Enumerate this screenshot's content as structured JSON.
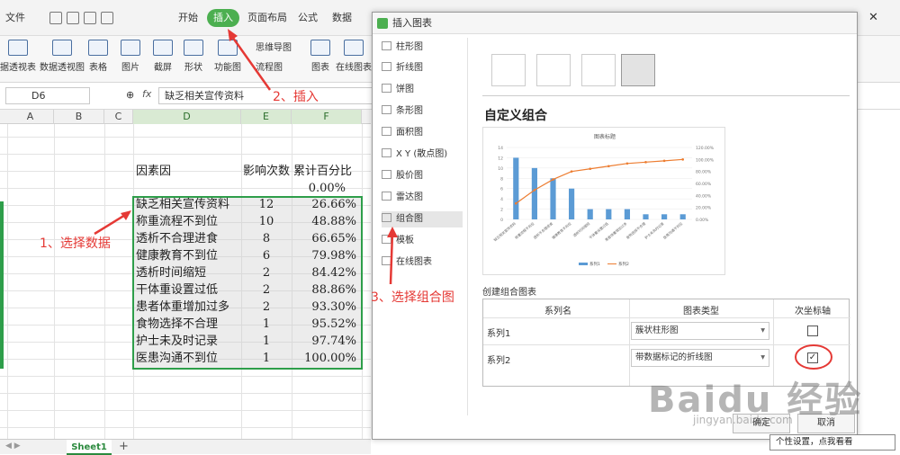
{
  "menubar": {
    "file": "文件",
    "tabs": [
      "开始",
      "插入",
      "页面布局",
      "公式",
      "数据"
    ]
  },
  "ribbon": {
    "buttons": [
      "据透视表",
      "数据透视图",
      "表格",
      "图片",
      "截屏",
      "形状",
      "功能图",
      "思维导图",
      "流程图",
      "图表",
      "在线图表"
    ]
  },
  "formula": {
    "namebox": "D6",
    "fx": "fx",
    "content": "缺乏相关宣传资料"
  },
  "sheet": {
    "columns": [
      "A",
      "B",
      "C",
      "D",
      "E",
      "F"
    ],
    "headers": {
      "d": "因素因",
      "e": "影响次数",
      "f": "累计百分比"
    },
    "first_pct": "0.00%",
    "rows": [
      {
        "d": "缺乏相关宣传资料",
        "e": "12",
        "f": "26.66%"
      },
      {
        "d": "称重流程不到位",
        "e": "10",
        "f": "48.88%"
      },
      {
        "d": "透析不合理进食",
        "e": "8",
        "f": "66.65%"
      },
      {
        "d": "健康教育不到位",
        "e": "6",
        "f": "79.98%"
      },
      {
        "d": "透析时间缩短",
        "e": "2",
        "f": "84.42%"
      },
      {
        "d": "干体重设置过低",
        "e": "2",
        "f": "88.86%"
      },
      {
        "d": "患者体重增加过多",
        "e": "2",
        "f": "93.30%"
      },
      {
        "d": "食物选择不合理",
        "e": "1",
        "f": "95.52%"
      },
      {
        "d": "护士未及时记录",
        "e": "1",
        "f": "97.74%"
      },
      {
        "d": "医患沟通不到位",
        "e": "1",
        "f": "100.00%"
      }
    ],
    "tab": "Sheet1"
  },
  "annotations": {
    "select_data": "1、选择数据",
    "insert": "2、插入",
    "combo": "3、选择组合图"
  },
  "dialog": {
    "title": "插入图表",
    "categories": [
      "柱形图",
      "折线图",
      "饼图",
      "条形图",
      "面积图",
      "X Y (散点图)",
      "股价图",
      "雷达图",
      "组合图",
      "模板",
      "在线图表"
    ],
    "heading": "自定义组合",
    "create_label": "创建组合图表",
    "table_headers": {
      "name": "系列名",
      "type": "图表类型",
      "axis": "次坐标轴"
    },
    "series": [
      {
        "name": "系列1",
        "type": "簇状柱形图",
        "secondary": false
      },
      {
        "name": "系列2",
        "type": "带数据标记的折线图",
        "secondary": true
      }
    ],
    "ok": "确定",
    "cancel": "取消"
  },
  "preview": {
    "title": "图表标题",
    "legend": [
      "系列1",
      "系列2"
    ]
  },
  "chart_data": {
    "type": "bar",
    "title": "图表标题",
    "categories": [
      "缺乏相关宣传资料",
      "称重流程不到位",
      "透析不合理进食",
      "健康教育不到位",
      "透析时间缩短",
      "干体重设置过低",
      "患者体重增加过多",
      "食物选择不合理",
      "护士未及时记录",
      "医患沟通不到位"
    ],
    "series": [
      {
        "name": "系列1",
        "type": "bar",
        "axis": "primary",
        "values": [
          12,
          10,
          8,
          6,
          2,
          2,
          2,
          1,
          1,
          1
        ]
      },
      {
        "name": "系列2",
        "type": "line",
        "axis": "secondary",
        "values": [
          26.66,
          48.88,
          66.65,
          79.98,
          84.42,
          88.86,
          93.3,
          95.52,
          97.74,
          100.0
        ]
      }
    ],
    "ylim": [
      0,
      14
    ],
    "y2lim": [
      0,
      120
    ],
    "grid": true,
    "legend": "bottom",
    "colors": {
      "bar": "#5b9bd5",
      "line": "#ed7d31"
    }
  },
  "tooltip": "个性设置，点我看看",
  "watermark": {
    "text": "Baidu 经验",
    "url": "jingyan.baidu.com"
  }
}
